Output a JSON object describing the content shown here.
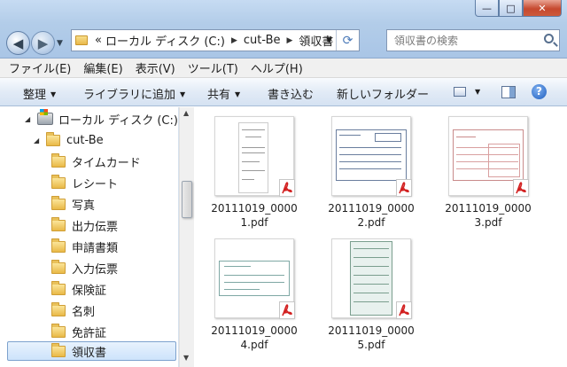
{
  "window": {
    "minimize": "—",
    "maximize": "□",
    "close": "✕"
  },
  "address": {
    "prefix": "«",
    "crumbs": [
      "ローカル ディスク (C:)",
      "cut-Be",
      "領収書"
    ]
  },
  "search": {
    "placeholder": "領収書の検索"
  },
  "menu": [
    "ファイル(E)",
    "編集(E)",
    "表示(V)",
    "ツール(T)",
    "ヘルプ(H)"
  ],
  "toolbar": {
    "organize": "整理",
    "library": "ライブラリに追加",
    "share": "共有",
    "burn": "書き込む",
    "new_folder": "新しいフォルダー"
  },
  "tree": [
    {
      "label": "ローカル ディスク (C:)",
      "type": "drive"
    },
    {
      "label": "cut-Be",
      "type": "folder"
    },
    {
      "label": "タイムカード",
      "type": "folder"
    },
    {
      "label": "レシート",
      "type": "folder"
    },
    {
      "label": "写真",
      "type": "folder"
    },
    {
      "label": "出力伝票",
      "type": "folder"
    },
    {
      "label": "申請書類",
      "type": "folder"
    },
    {
      "label": "入力伝票",
      "type": "folder"
    },
    {
      "label": "保険証",
      "type": "folder"
    },
    {
      "label": "名刺",
      "type": "folder"
    },
    {
      "label": "免許証",
      "type": "folder"
    },
    {
      "label": "領収書",
      "type": "folder",
      "selected": true
    }
  ],
  "files": [
    {
      "name": "20111019_00001.pdf",
      "line1": "20111019_0000",
      "line2": "1.pdf",
      "icon": "pdf-icon"
    },
    {
      "name": "20111019_00002.pdf",
      "line1": "20111019_0000",
      "line2": "2.pdf",
      "icon": "pdf-icon"
    },
    {
      "name": "20111019_00003.pdf",
      "line1": "20111019_0000",
      "line2": "3.pdf",
      "icon": "pdf-icon"
    },
    {
      "name": "20111019_00004.pdf",
      "line1": "20111019_0000",
      "line2": "4.pdf",
      "icon": "pdf-icon"
    },
    {
      "name": "20111019_00005.pdf",
      "line1": "20111019_0000",
      "line2": "5.pdf",
      "icon": "pdf-icon"
    }
  ],
  "colors": {
    "pdf_red": "#d21f1f",
    "selection": "#cde3fb"
  }
}
